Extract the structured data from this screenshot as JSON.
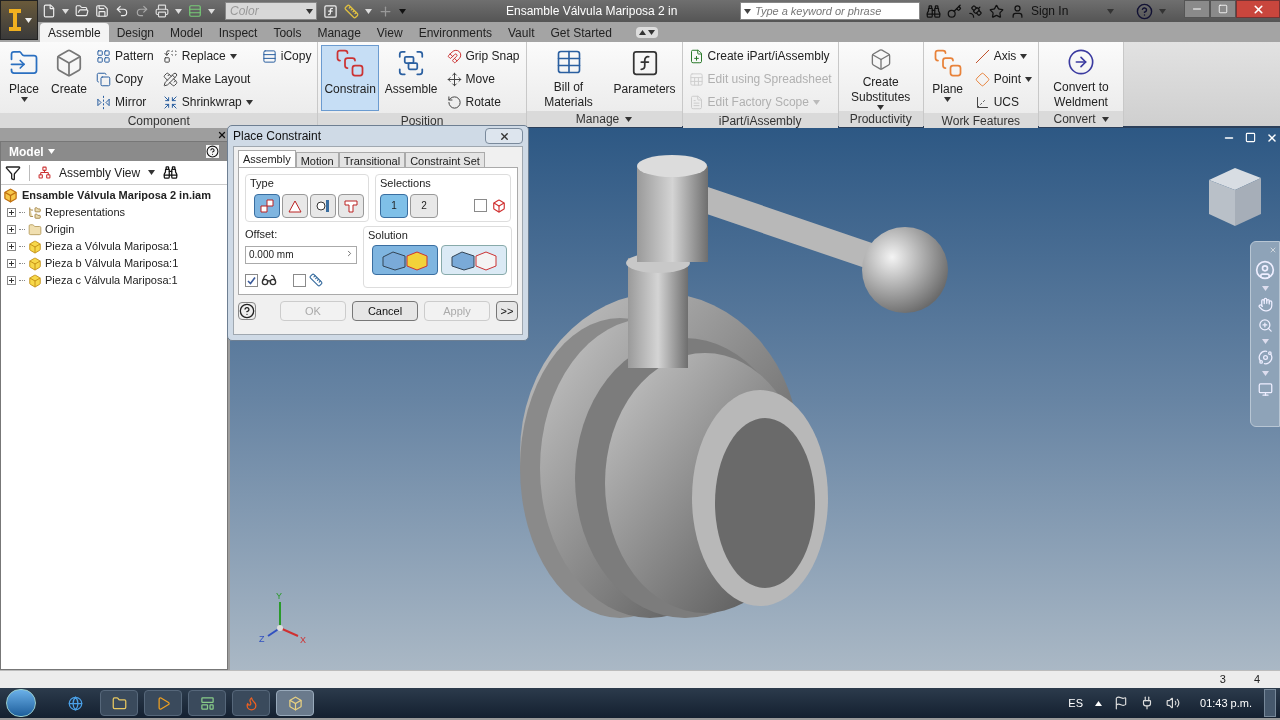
{
  "titlebar": {
    "color_placeholder": "Color",
    "title": "Ensamble Válvula Mariposa 2 in",
    "search_placeholder": "Type a keyword or phrase",
    "sign_in": "Sign In"
  },
  "tabs": [
    {
      "label": "Assemble",
      "selected": true
    },
    {
      "label": "Design",
      "selected": false
    },
    {
      "label": "Model",
      "selected": false
    },
    {
      "label": "Inspect",
      "selected": false
    },
    {
      "label": "Tools",
      "selected": false
    },
    {
      "label": "Manage",
      "selected": false
    },
    {
      "label": "View",
      "selected": false
    },
    {
      "label": "Environments",
      "selected": false
    },
    {
      "label": "Vault",
      "selected": false
    },
    {
      "label": "Get Started",
      "selected": false
    }
  ],
  "ribbon": [
    {
      "title": "Component",
      "menu": false,
      "columns": [
        {
          "kind": "large",
          "items": [
            {
              "label": "Place",
              "dropdown": true,
              "selected": false,
              "disabled": false
            }
          ]
        },
        {
          "kind": "large",
          "items": [
            {
              "label": "Create",
              "dropdown": false,
              "selected": false,
              "disabled": false
            }
          ]
        },
        {
          "kind": "small",
          "items": [
            {
              "label": "Pattern",
              "dropdown": false,
              "selected": false,
              "disabled": false
            },
            {
              "label": "Copy",
              "dropdown": false,
              "selected": false,
              "disabled": false
            },
            {
              "label": "Mirror",
              "dropdown": false,
              "selected": false,
              "disabled": false
            }
          ]
        },
        {
          "kind": "small",
          "items": [
            {
              "label": "Replace",
              "dropdown": true,
              "selected": false,
              "disabled": false
            },
            {
              "label": "Make Layout",
              "dropdown": false,
              "selected": false,
              "disabled": false
            },
            {
              "label": "Shrinkwrap",
              "dropdown": true,
              "selected": false,
              "disabled": false
            }
          ]
        },
        {
          "kind": "small",
          "items": [
            {
              "label": "iCopy",
              "dropdown": false,
              "selected": false,
              "disabled": false
            }
          ]
        }
      ]
    },
    {
      "title": "Position",
      "menu": false,
      "columns": [
        {
          "kind": "large",
          "items": [
            {
              "label": "Constrain",
              "dropdown": false,
              "selected": true,
              "disabled": false
            }
          ]
        },
        {
          "kind": "large",
          "items": [
            {
              "label": "Assemble",
              "dropdown": false,
              "selected": false,
              "disabled": false
            }
          ]
        },
        {
          "kind": "small",
          "items": [
            {
              "label": "Grip Snap",
              "dropdown": false,
              "selected": false,
              "disabled": false
            },
            {
              "label": "Move",
              "dropdown": false,
              "selected": false,
              "disabled": false
            },
            {
              "label": "Rotate",
              "dropdown": false,
              "selected": false,
              "disabled": false
            }
          ]
        }
      ]
    },
    {
      "title": "Manage",
      "menu": true,
      "columns": [
        {
          "kind": "large",
          "items": [
            {
              "label": "Bill of Materials",
              "dropdown": false,
              "selected": false,
              "disabled": false
            }
          ]
        },
        {
          "kind": "large",
          "items": [
            {
              "label": "Parameters",
              "dropdown": false,
              "selected": false,
              "disabled": false
            }
          ]
        }
      ]
    },
    {
      "title": "iPart/iAssembly",
      "menu": false,
      "columns": [
        {
          "kind": "small",
          "items": [
            {
              "label": "Create iPart/iAssembly",
              "dropdown": false,
              "selected": false,
              "disabled": false
            },
            {
              "label": "Edit using Spreadsheet",
              "dropdown": false,
              "selected": false,
              "disabled": true
            },
            {
              "label": "Edit Factory Scope",
              "dropdown": true,
              "selected": false,
              "disabled": true
            }
          ]
        }
      ]
    },
    {
      "title": "Productivity",
      "menu": false,
      "columns": [
        {
          "kind": "large",
          "items": [
            {
              "label": "Create Substitutes",
              "dropdown": true,
              "selected": false,
              "disabled": false
            }
          ]
        }
      ]
    },
    {
      "title": "Work Features",
      "menu": false,
      "columns": [
        {
          "kind": "large",
          "items": [
            {
              "label": "Plane",
              "dropdown": true,
              "selected": false,
              "disabled": false
            }
          ]
        },
        {
          "kind": "small",
          "items": [
            {
              "label": "Axis",
              "dropdown": true,
              "selected": false,
              "disabled": false
            },
            {
              "label": "Point",
              "dropdown": true,
              "selected": false,
              "disabled": false
            },
            {
              "label": "UCS",
              "dropdown": false,
              "selected": false,
              "disabled": false
            }
          ]
        }
      ]
    },
    {
      "title": "Convert",
      "menu": true,
      "columns": [
        {
          "kind": "large",
          "items": [
            {
              "label": "Convert to Weldment",
              "dropdown": false,
              "selected": false,
              "disabled": false
            }
          ]
        }
      ]
    }
  ],
  "browser": {
    "title": "Model",
    "view": "Assembly View",
    "root": "Ensamble Válvula Mariposa 2 in.iam",
    "items": [
      {
        "label": "Representations",
        "kind": "representations",
        "expanded": false
      },
      {
        "label": "Origin",
        "kind": "folder",
        "expanded": false
      },
      {
        "label": "Pieza a Vólvula Mariposa:1",
        "kind": "part_active",
        "expanded": false
      },
      {
        "label": "Pieza b Válvula Mariposa:1",
        "kind": "part",
        "expanded": false
      },
      {
        "label": "Pieza c Válvula Mariposa:1",
        "kind": "part",
        "expanded": false
      }
    ]
  },
  "dialog": {
    "title": "Place Constraint",
    "tabs": [
      {
        "label": "Assembly",
        "selected": true
      },
      {
        "label": "Motion",
        "selected": false
      },
      {
        "label": "Transitional",
        "selected": false
      },
      {
        "label": "Constraint Set",
        "selected": false
      }
    ],
    "type_label": "Type",
    "types": [
      {
        "selected": true
      },
      {
        "selected": false
      },
      {
        "selected": false
      },
      {
        "selected": false
      }
    ],
    "selections_label": "Selections",
    "selections": [
      {
        "label": "1",
        "selected": true
      },
      {
        "label": "2",
        "selected": false
      }
    ],
    "pick_part_first": {
      "checked": false
    },
    "offset_label": "Offset:",
    "offset_value": "0.000 mm",
    "solution_label": "Solution",
    "solutions": [
      {
        "selected": true
      },
      {
        "selected": false
      }
    ],
    "show_preview": {
      "checked": true
    },
    "predict_offset": {
      "checked": false
    },
    "buttons": [
      {
        "label": "OK",
        "disabled": true
      },
      {
        "label": "Cancel",
        "disabled": false
      },
      {
        "label": "Apply",
        "disabled": true
      },
      {
        "label": ">>",
        "disabled": false
      }
    ]
  },
  "triad": [
    "Y",
    "Z",
    "X"
  ],
  "status_bar": [
    "3",
    "4"
  ],
  "taskbar": {
    "language": "ES",
    "time": "01:43 p.m."
  }
}
